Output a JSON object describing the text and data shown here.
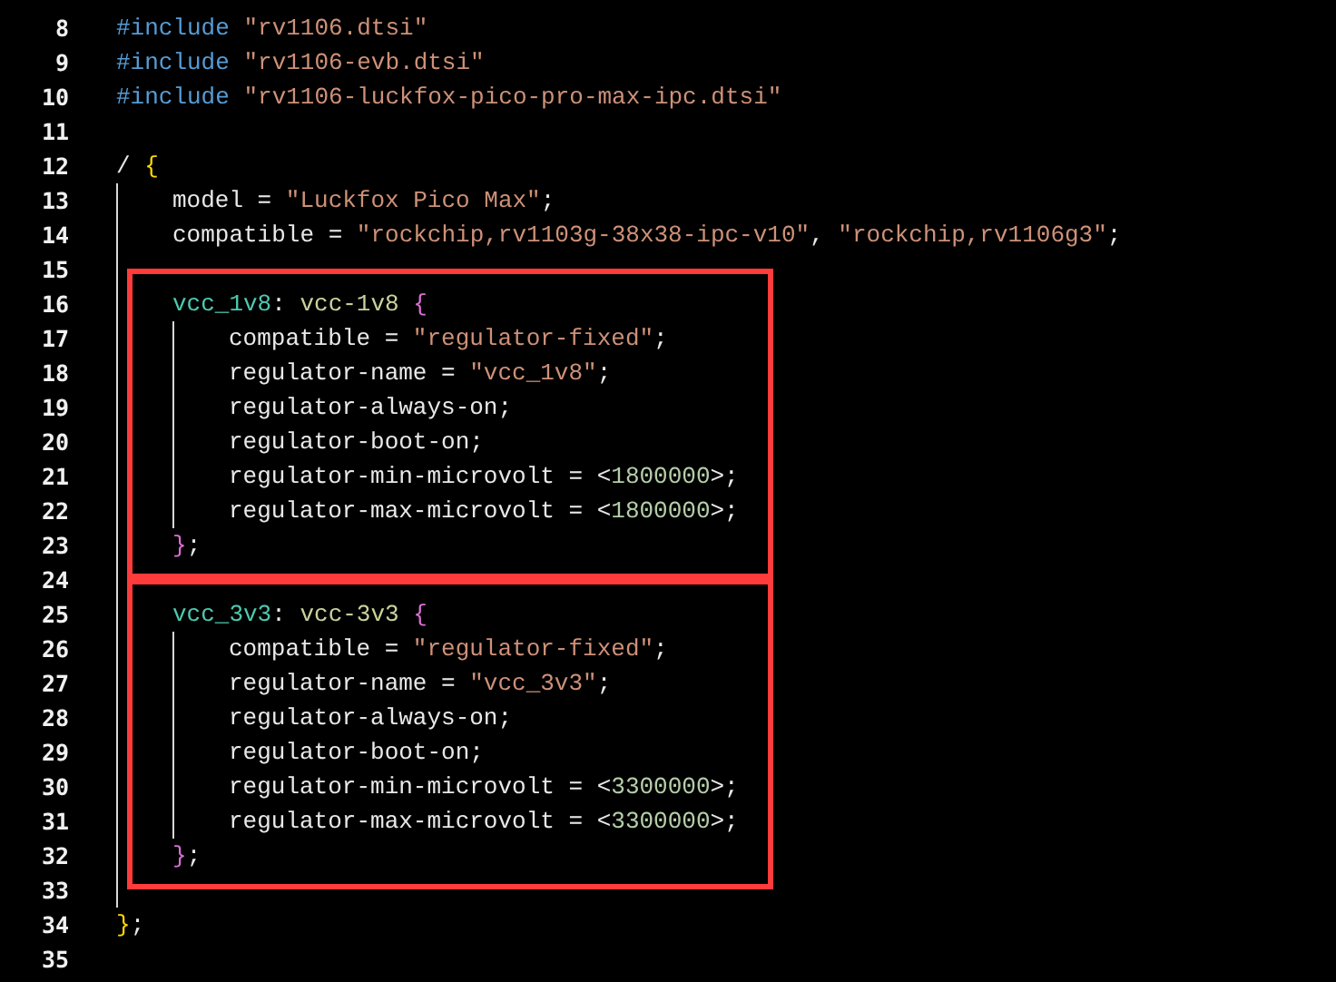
{
  "lines": [
    {
      "number": "8",
      "tokens": [
        {
          "text": "#include ",
          "kind": "directive"
        },
        {
          "text": "\"rv1106.dtsi\"",
          "kind": "string"
        }
      ]
    },
    {
      "number": "9",
      "tokens": [
        {
          "text": "#include ",
          "kind": "directive"
        },
        {
          "text": "\"rv1106-evb.dtsi\"",
          "kind": "string"
        }
      ]
    },
    {
      "number": "10",
      "tokens": [
        {
          "text": "#include ",
          "kind": "directive"
        },
        {
          "text": "\"rv1106-luckfox-pico-pro-max-ipc.dtsi\"",
          "kind": "string"
        }
      ]
    },
    {
      "number": "11"
    },
    {
      "number": "12",
      "tokens": [
        {
          "text": "/ ",
          "kind": "plain"
        },
        {
          "text": "{",
          "kind": "brace_outer"
        }
      ],
      "children": [
        {
          "number": "13",
          "tokens": [
            {
              "text": "model = ",
              "kind": "plain"
            },
            {
              "text": "\"Luckfox Pico Max\"",
              "kind": "string"
            },
            {
              "text": ";",
              "kind": "plain"
            }
          ]
        },
        {
          "number": "14",
          "tokens": [
            {
              "text": "compatible = ",
              "kind": "plain"
            },
            {
              "text": "\"rockchip,rv1103g-38x38-ipc-v10\"",
              "kind": "string"
            },
            {
              "text": ", ",
              "kind": "plain"
            },
            {
              "text": "\"rockchip,rv1106g3\"",
              "kind": "string"
            },
            {
              "text": ";",
              "kind": "plain"
            }
          ]
        },
        {
          "number": "15"
        },
        {
          "number": "16",
          "highlighted": true,
          "tokens": [
            {
              "text": "vcc_1v8",
              "kind": "label"
            },
            {
              "text": ": ",
              "kind": "plain"
            },
            {
              "text": "vcc-1v8 ",
              "kind": "node"
            },
            {
              "text": "{",
              "kind": "brace_inner"
            }
          ],
          "children": [
            {
              "number": "17",
              "tokens": [
                {
                  "text": "compatible = ",
                  "kind": "plain"
                },
                {
                  "text": "\"regulator-fixed\"",
                  "kind": "string"
                },
                {
                  "text": ";",
                  "kind": "plain"
                }
              ]
            },
            {
              "number": "18",
              "tokens": [
                {
                  "text": "regulator-name = ",
                  "kind": "plain"
                },
                {
                  "text": "\"vcc_1v8\"",
                  "kind": "string"
                },
                {
                  "text": ";",
                  "kind": "plain"
                }
              ]
            },
            {
              "number": "19",
              "tokens": [
                {
                  "text": "regulator-always-on;",
                  "kind": "plain"
                }
              ]
            },
            {
              "number": "20",
              "tokens": [
                {
                  "text": "regulator-boot-on;",
                  "kind": "plain"
                }
              ]
            },
            {
              "number": "21",
              "tokens": [
                {
                  "text": "regulator-min-microvolt = <",
                  "kind": "plain"
                },
                {
                  "text": "1800000",
                  "kind": "number"
                },
                {
                  "text": ">;",
                  "kind": "plain"
                }
              ]
            },
            {
              "number": "22",
              "tokens": [
                {
                  "text": "regulator-max-microvolt = <",
                  "kind": "plain"
                },
                {
                  "text": "1800000",
                  "kind": "number"
                },
                {
                  "text": ">;",
                  "kind": "plain"
                }
              ]
            }
          ],
          "close": {
            "number": "23",
            "tokens": [
              {
                "text": "}",
                "kind": "brace_inner"
              },
              {
                "text": ";",
                "kind": "plain"
              }
            ]
          }
        },
        {
          "number": "24"
        },
        {
          "number": "25",
          "highlighted": true,
          "tokens": [
            {
              "text": "vcc_3v3",
              "kind": "label"
            },
            {
              "text": ": ",
              "kind": "plain"
            },
            {
              "text": "vcc-3v3 ",
              "kind": "node"
            },
            {
              "text": "{",
              "kind": "brace_inner"
            }
          ],
          "children": [
            {
              "number": "26",
              "tokens": [
                {
                  "text": "compatible = ",
                  "kind": "plain"
                },
                {
                  "text": "\"regulator-fixed\"",
                  "kind": "string"
                },
                {
                  "text": ";",
                  "kind": "plain"
                }
              ]
            },
            {
              "number": "27",
              "tokens": [
                {
                  "text": "regulator-name = ",
                  "kind": "plain"
                },
                {
                  "text": "\"vcc_3v3\"",
                  "kind": "string"
                },
                {
                  "text": ";",
                  "kind": "plain"
                }
              ]
            },
            {
              "number": "28",
              "tokens": [
                {
                  "text": "regulator-always-on;",
                  "kind": "plain"
                }
              ]
            },
            {
              "number": "29",
              "tokens": [
                {
                  "text": "regulator-boot-on;",
                  "kind": "plain"
                }
              ]
            },
            {
              "number": "30",
              "tokens": [
                {
                  "text": "regulator-min-microvolt = <",
                  "kind": "plain"
                },
                {
                  "text": "3300000",
                  "kind": "number"
                },
                {
                  "text": ">;",
                  "kind": "plain"
                }
              ]
            },
            {
              "number": "31",
              "tokens": [
                {
                  "text": "regulator-max-microvolt = <",
                  "kind": "plain"
                },
                {
                  "text": "3300000",
                  "kind": "number"
                },
                {
                  "text": ">;",
                  "kind": "plain"
                }
              ]
            }
          ],
          "close": {
            "number": "32",
            "tokens": [
              {
                "text": "}",
                "kind": "brace_inner"
              },
              {
                "text": ";",
                "kind": "plain"
              }
            ]
          }
        },
        {
          "number": "33"
        }
      ],
      "close": {
        "number": "34",
        "tokens": [
          {
            "text": "}",
            "kind": "brace_outer"
          },
          {
            "text": ";",
            "kind": "plain"
          }
        ]
      }
    },
    {
      "number": "35"
    }
  ]
}
